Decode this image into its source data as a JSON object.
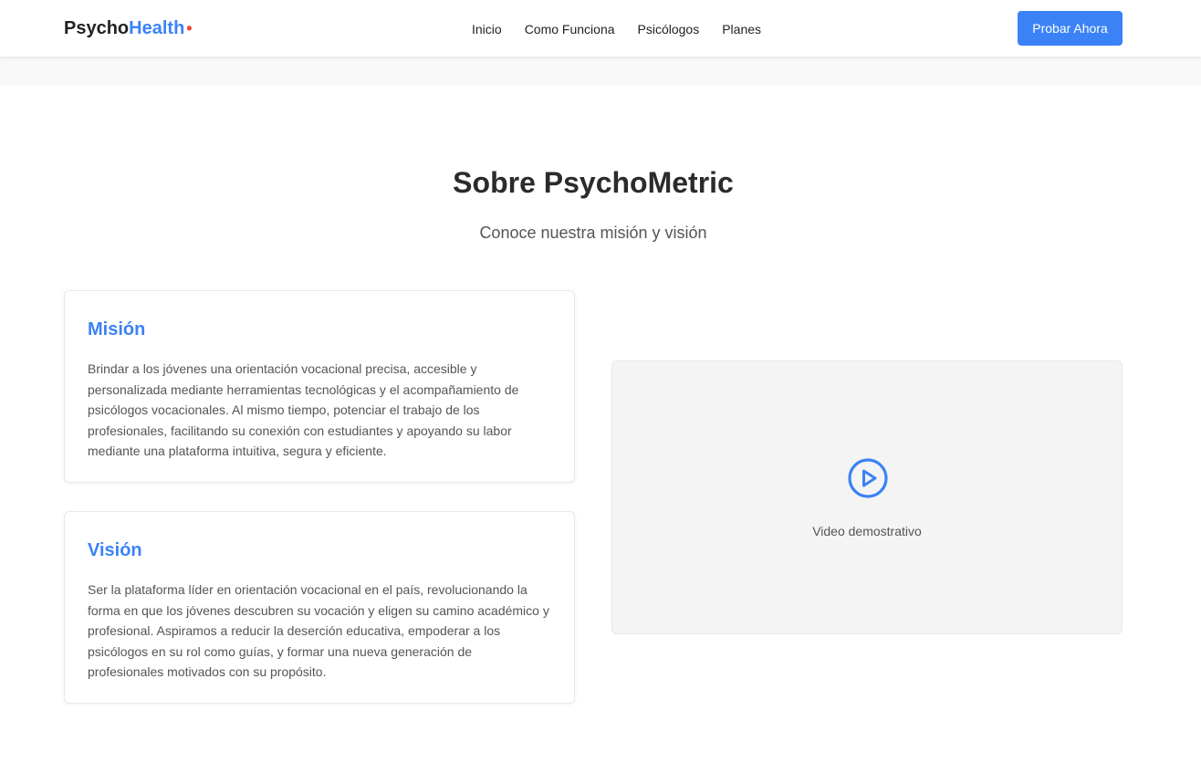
{
  "header": {
    "logo_primary": "Psycho",
    "logo_accent": "Health",
    "logo_dot": "•",
    "nav": [
      "Inicio",
      "Como Funciona",
      "Psicólogos",
      "Planes"
    ],
    "cta_label": "Probar Ahora"
  },
  "about": {
    "title": "Sobre PsychoMetric",
    "subtitle": "Conoce nuestra misión y visión",
    "mision": {
      "heading": "Misión",
      "text": "Brindar a los jóvenes una orientación vocacional precisa, accesible y personalizada mediante herramientas tecnológicas y el acompañamiento de psicólogos vocacionales. Al mismo tiempo, potenciar el trabajo de los profesionales, facilitando su conexión con estudiantes y apoyando su labor mediante una plataforma intuitiva, segura y eficiente."
    },
    "vision": {
      "heading": "Visión",
      "text": "Ser la plataforma líder en orientación vocacional en el país, revolucionando la forma en que los jóvenes descubren su vocación y eligen su camino académico y profesional. Aspiramos a reducir la deserción educativa, empoderar a los psicólogos en su rol como guías, y formar una nueva generación de profesionales motivados con su propósito."
    },
    "video": {
      "label": "Video demostrativo",
      "icon": "play-circle-icon"
    }
  },
  "colors": {
    "accent": "#3b82f6",
    "logo_dot": "#ef4444",
    "video_bg": "#f4f4f4"
  }
}
